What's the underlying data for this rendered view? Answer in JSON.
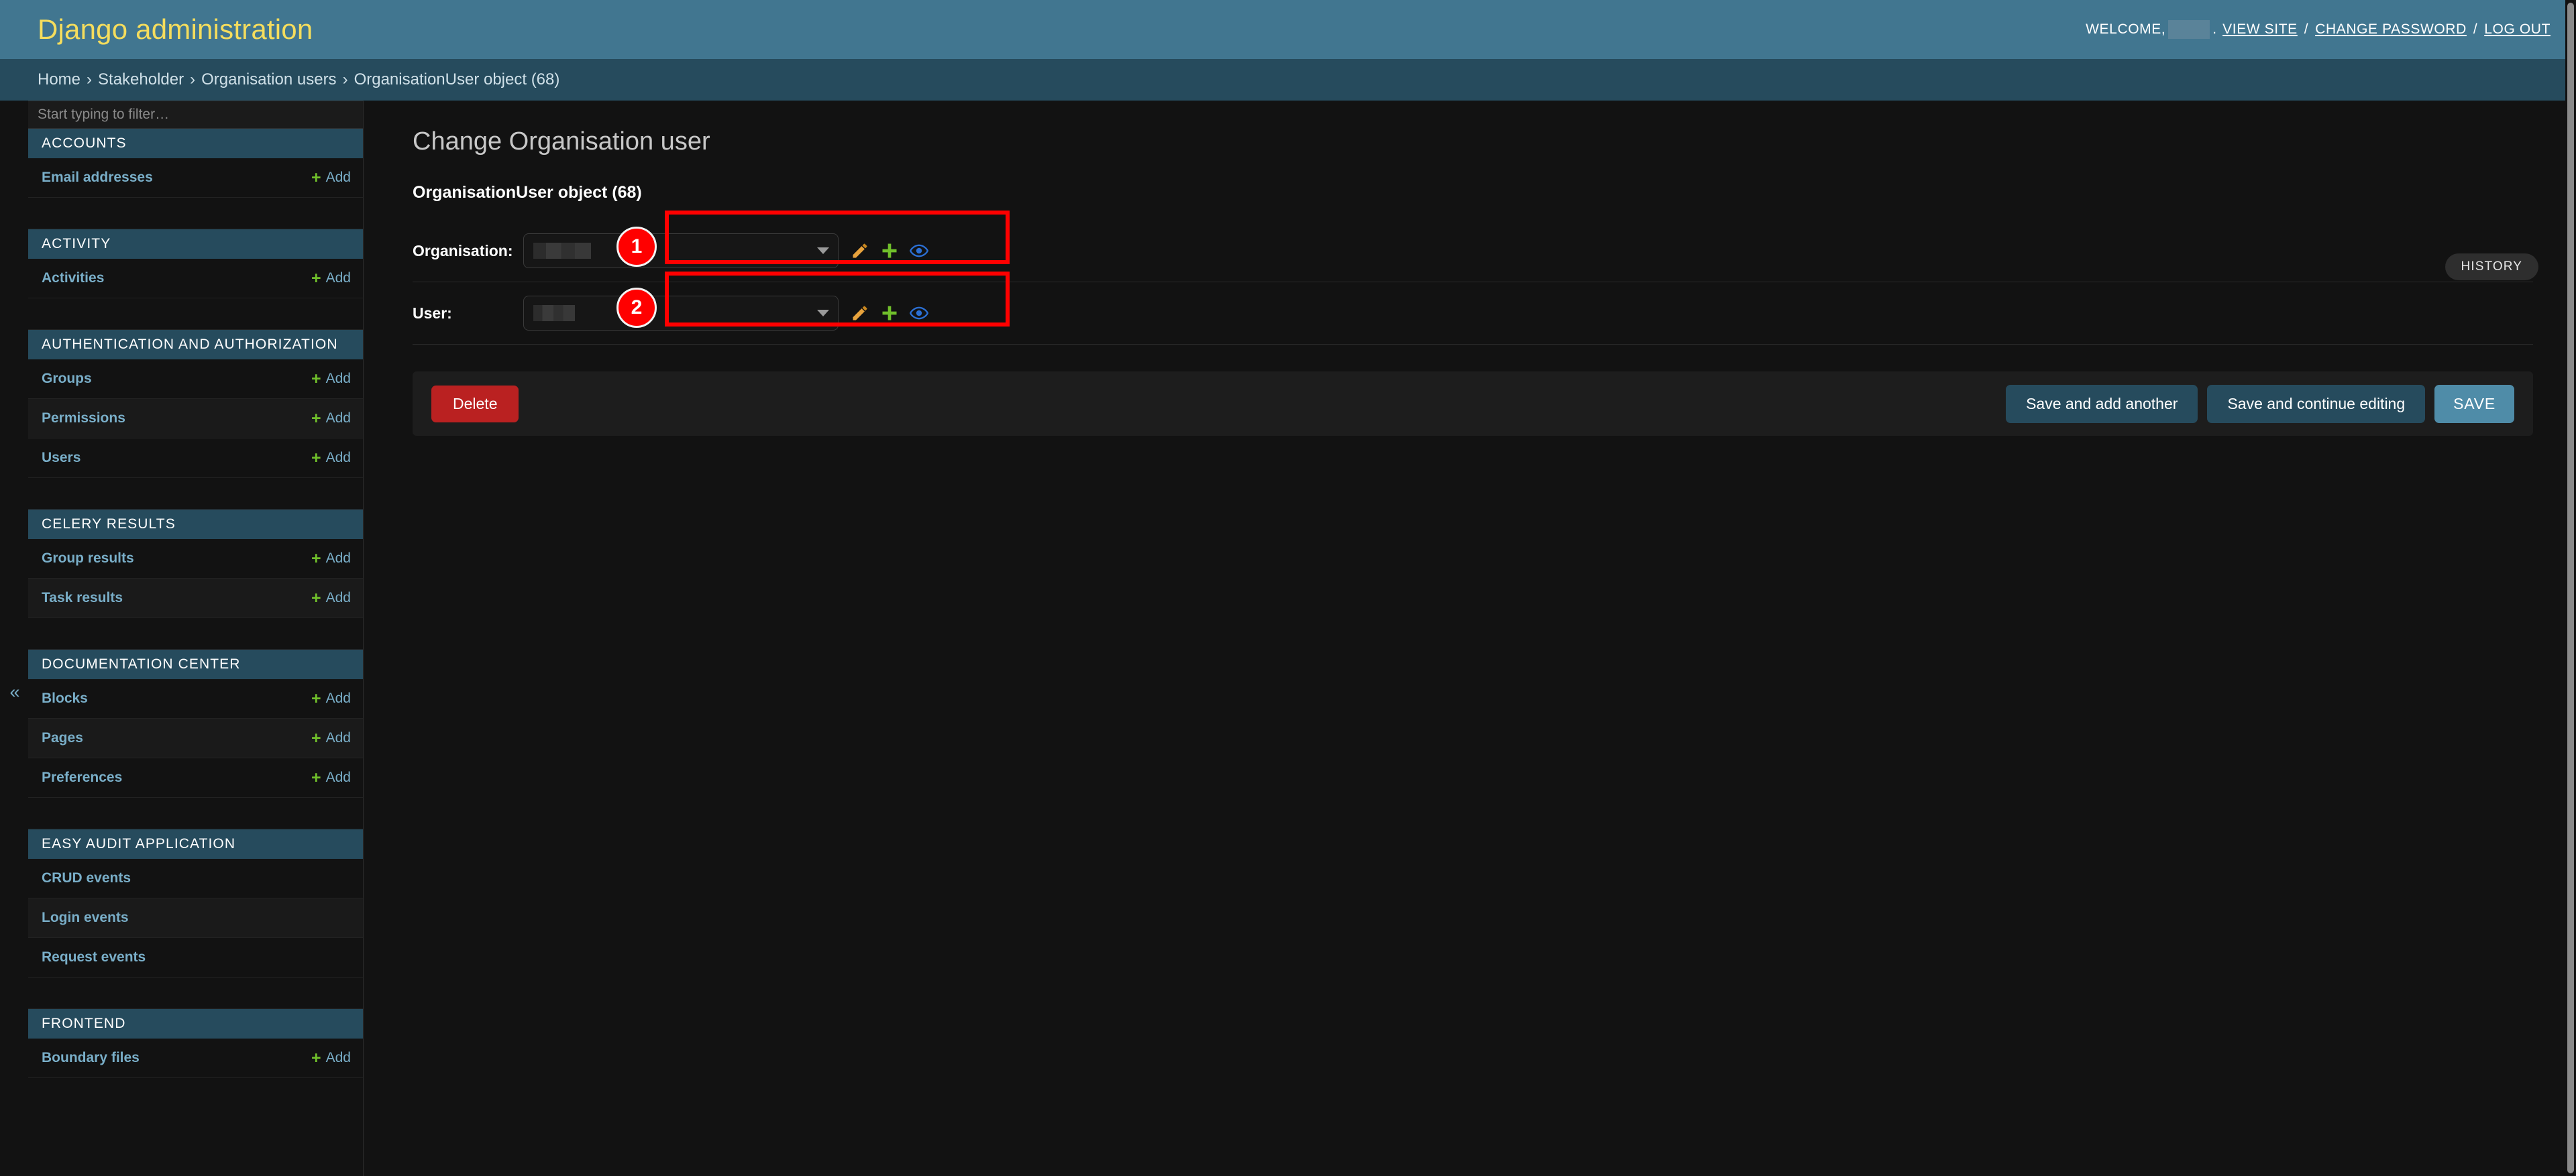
{
  "header": {
    "branding": "Django administration",
    "welcome_label": "WELCOME,",
    "username_redacted": "",
    "period": ".",
    "links": [
      {
        "label": "VIEW SITE",
        "name": "view-site-link"
      },
      {
        "label": "CHANGE PASSWORD",
        "name": "change-password-link"
      },
      {
        "label": "LOG OUT",
        "name": "log-out-link"
      }
    ],
    "separator": "/"
  },
  "breadcrumbs": {
    "separator": "›",
    "items": [
      {
        "label": "Home"
      },
      {
        "label": "Stakeholder"
      },
      {
        "label": "Organisation users"
      },
      {
        "label": "OrganisationUser object (68)"
      }
    ]
  },
  "sidebar": {
    "filter_placeholder": "Start typing to filter…",
    "filter_value": "",
    "collapse_icon": "«",
    "add_label": "Add",
    "plus_icon": "+",
    "apps": [
      {
        "title": "ACCOUNTS",
        "models": [
          {
            "label": "Email addresses",
            "add": true
          }
        ]
      },
      {
        "title": "ACTIVITY",
        "models": [
          {
            "label": "Activities",
            "add": true
          }
        ]
      },
      {
        "title": "AUTHENTICATION AND AUTHORIZATION",
        "models": [
          {
            "label": "Groups",
            "add": true
          },
          {
            "label": "Permissions",
            "add": true
          },
          {
            "label": "Users",
            "add": true
          }
        ]
      },
      {
        "title": "CELERY RESULTS",
        "models": [
          {
            "label": "Group results",
            "add": true
          },
          {
            "label": "Task results",
            "add": true
          }
        ]
      },
      {
        "title": "DOCUMENTATION CENTER",
        "models": [
          {
            "label": "Blocks",
            "add": true
          },
          {
            "label": "Pages",
            "add": true
          },
          {
            "label": "Preferences",
            "add": true
          }
        ]
      },
      {
        "title": "EASY AUDIT APPLICATION",
        "models": [
          {
            "label": "CRUD events",
            "add": false
          },
          {
            "label": "Login events",
            "add": false
          },
          {
            "label": "Request events",
            "add": false
          }
        ]
      },
      {
        "title": "FRONTEND",
        "models": [
          {
            "label": "Boundary files",
            "add": true
          }
        ]
      }
    ]
  },
  "content": {
    "title": "Change Organisation user",
    "history_label": "HISTORY",
    "object_caption": "OrganisationUser object (68)",
    "fields": [
      {
        "label": "Organisation:",
        "value_redacted": "",
        "annotation": "1",
        "related_icons": [
          {
            "name": "edit-pencil-icon",
            "title": "Change selected Organisation"
          },
          {
            "name": "add-plus-icon",
            "title": "Add another Organisation"
          },
          {
            "name": "view-eye-icon",
            "title": "View selected Organisation"
          }
        ]
      },
      {
        "label": "User:",
        "value_redacted": "",
        "annotation": "2",
        "related_icons": [
          {
            "name": "edit-pencil-icon",
            "title": "Change selected User"
          },
          {
            "name": "add-plus-icon",
            "title": "Add another User"
          },
          {
            "name": "view-eye-icon",
            "title": "View selected User"
          }
        ]
      }
    ],
    "buttons": {
      "delete": "Delete",
      "save_add_another": "Save and add another",
      "save_continue": "Save and continue editing",
      "save": "SAVE"
    }
  },
  "colors": {
    "header_bg": "#417690",
    "breadcrumb_bg": "#264b5d",
    "page_bg": "#121212",
    "brand_text": "#f5dd5d",
    "link_blue": "#79aec8",
    "plus_green": "#70bf2b",
    "delete_red": "#ba2121",
    "save_blue": "#4f8ca8",
    "annotation_red": "#ff0000",
    "pencil_yellow": "#e8a33d",
    "eye_blue": "#2b6fd4"
  }
}
